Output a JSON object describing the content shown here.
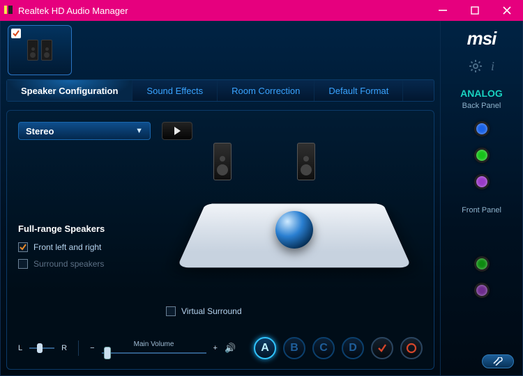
{
  "window": {
    "title": "Realtek HD Audio Manager"
  },
  "brand": "msi",
  "tabs": [
    {
      "label": "Speaker Configuration",
      "active": true
    },
    {
      "label": "Sound Effects"
    },
    {
      "label": "Room Correction"
    },
    {
      "label": "Default Format"
    }
  ],
  "speaker_config": {
    "mode": "Stereo",
    "virtual_surround_label": "Virtual Surround",
    "virtual_surround_checked": false,
    "full_range_heading": "Full-range Speakers",
    "front_lr_label": "Front left and right",
    "front_lr_checked": true,
    "surround_label": "Surround speakers",
    "surround_checked": false
  },
  "bottom": {
    "balance_left": "L",
    "balance_right": "R",
    "minus": "−",
    "plus": "+",
    "main_volume_label": "Main Volume",
    "presets": [
      "A",
      "B",
      "C",
      "D"
    ],
    "active_preset": 0
  },
  "side": {
    "analog_label": "ANALOG",
    "back_panel_label": "Back Panel",
    "front_panel_label": "Front Panel",
    "back_jacks": [
      {
        "name": "line-in-jack",
        "color": "blue"
      },
      {
        "name": "line-out-jack",
        "color": "green"
      },
      {
        "name": "mic-jack",
        "color": "purple"
      }
    ],
    "front_jacks": [
      {
        "name": "front-headphone-jack",
        "color": "green2"
      },
      {
        "name": "front-mic-jack",
        "color": "purple2"
      }
    ]
  }
}
